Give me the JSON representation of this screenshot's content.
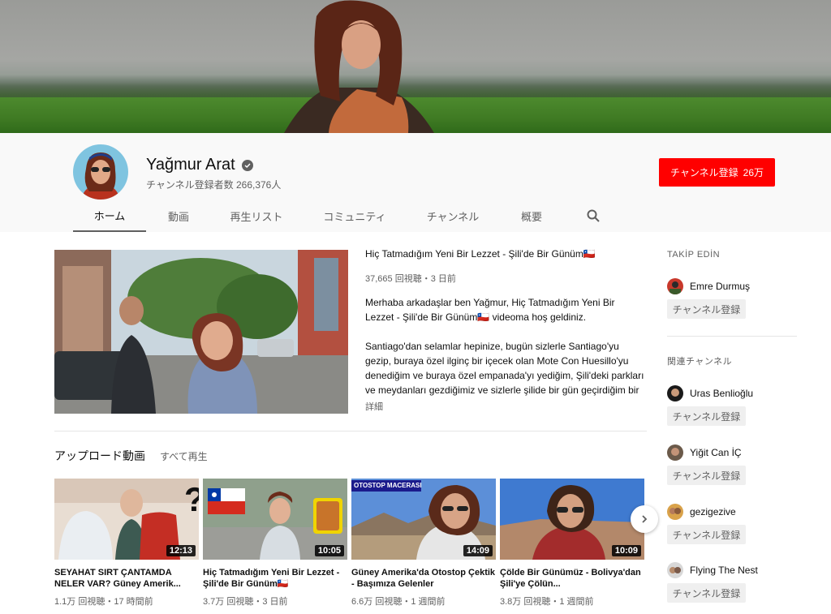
{
  "channel": {
    "name": "Yağmur Arat",
    "subscribers_text": "チャンネル登録者数 266,376人",
    "subscribe_label": "チャンネル登録",
    "subscribe_count": "26万"
  },
  "tabs": [
    {
      "label": "ホーム",
      "active": true
    },
    {
      "label": "動画"
    },
    {
      "label": "再生リスト"
    },
    {
      "label": "コミュニティ"
    },
    {
      "label": "チャンネル"
    },
    {
      "label": "概要"
    }
  ],
  "featured": {
    "title": "Hiç Tatmadığım Yeni Bir Lezzet - Şili'de Bir Günüm🇨🇱",
    "meta": "37,665 回視聴・3 日前",
    "desc_1": "Merhaba arkadaşlar ben Yağmur, Hiç Tatmadığım Yeni Bir Lezzet - Şili'de Bir Günüm🇨🇱   videoma hoş geldiniz.",
    "desc_2": "Santiago'dan selamlar hepinize, bugün sizlerle Santiago'yu gezip, buraya özel ilginç bir içecek olan Mote Con Huesillo'yu denediğim ve buraya özel empanada'yı yediğim, Şili'deki parkları ve meydanları gezdiğimiz ve sizlerle şilide bir gün geçirdiğim bir",
    "more": "詳細"
  },
  "uploads": {
    "title": "アップロード動画",
    "play_all": "すべて再生",
    "videos": [
      {
        "title": "SEYAHAT SIRT ÇANTAMDA NELER VAR? Güney Amerik...",
        "duration": "12:13",
        "meta": "1.1万 回視聴・17 時間前"
      },
      {
        "title": "Hiç Tatmadığım Yeni Bir Lezzet - Şili'de Bir Günüm🇨🇱",
        "duration": "10:05",
        "meta": "3.7万 回視聴・3 日前"
      },
      {
        "title": "Güney Amerika'da Otostop Çektik - Başımıza Gelenler",
        "duration": "14:09",
        "meta": "6.6万 回視聴・1 週間前",
        "thumb_text": "OTOSTOP MACERASI"
      },
      {
        "title": "Çölde Bir Günümüz - Bolivya'dan Şili'ye Çölün...",
        "duration": "10:09",
        "meta": "3.8万 回視聴・1 週間前"
      }
    ]
  },
  "sidebar": {
    "follow_title": "TAKİP EDİN",
    "featured_channel": {
      "name": "Emre Durmuş",
      "button": "チャンネル登録"
    },
    "related_title": "関連チャンネル",
    "related": [
      {
        "name": "Uras Benlioğlu",
        "button": "チャンネル登録"
      },
      {
        "name": "Yiğit Can İÇ",
        "button": "チャンネル登録"
      },
      {
        "name": "gezigezive",
        "button": "チャンネル登録"
      },
      {
        "name": "Flying The Nest",
        "button": "チャンネル登録"
      }
    ]
  },
  "colors": {
    "accent": "#ff0000",
    "muted": "#606060"
  }
}
